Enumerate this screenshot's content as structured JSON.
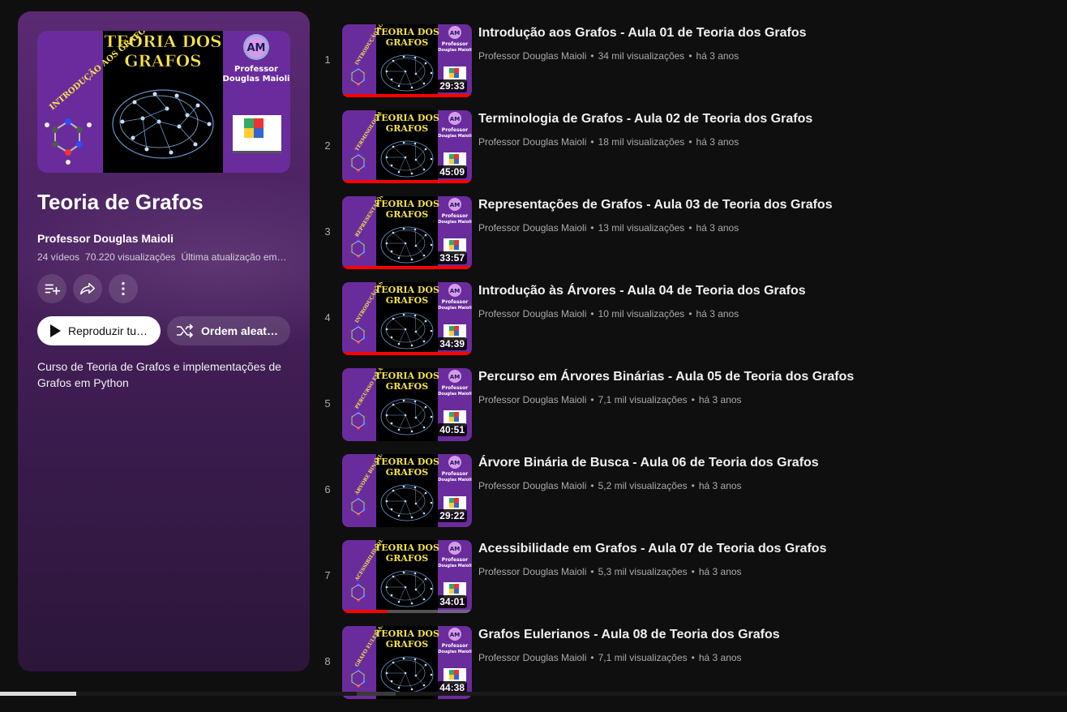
{
  "playlist": {
    "hero": {
      "top_title": "TEORIA DOS GRAFOS",
      "side_label": "INTRODUÇÃO AOS GRAFOS",
      "badge_initials": "AM",
      "badge_line1": "Professor",
      "badge_line2": "Douglas Maioli"
    },
    "title": "Teoria de Grafos",
    "owner": "Professor Douglas Maioli",
    "video_count": "24 vídeos",
    "views": "70.220 visualizações",
    "updated": "Última atualização em…",
    "play_label": "Reproduzir tu…",
    "shuffle_label": "Ordem aleató…",
    "description": "Curso de Teoria de Grafos e implementações de Grafos em Python"
  },
  "thumb_common": {
    "top_title": "TEORIA DOS GRAFOS",
    "badge_initials": "AM",
    "badge_line1": "Professor",
    "badge_line2": "Douglas Maioli"
  },
  "videos": [
    {
      "index": "1",
      "title": "Introdução aos Grafos - Aula 01 de Teoria dos Grafos",
      "channel": "Professor Douglas Maioli",
      "views": "34 mil visualizações",
      "age": "há 3 anos",
      "duration": "29:33",
      "side_label": "INTRODUÇÃO AOS GRAFOS",
      "progress": 1.0
    },
    {
      "index": "2",
      "title": "Terminologia de Grafos - Aula 02 de Teoria dos Grafos",
      "channel": "Professor Douglas Maioli",
      "views": "18 mil visualizações",
      "age": "há 3 anos",
      "duration": "45:09",
      "side_label": "TERMINOLOGIA",
      "progress": 1.0
    },
    {
      "index": "3",
      "title": "Representações de Grafos - Aula 03 de Teoria dos Grafos",
      "channel": "Professor Douglas Maioli",
      "views": "13 mil visualizações",
      "age": "há 3 anos",
      "duration": "33:57",
      "side_label": "REPRESENTAÇÕES DE GRAFOS",
      "progress": 1.0
    },
    {
      "index": "4",
      "title": "Introdução às Árvores - Aula 04 de Teoria dos Grafos",
      "channel": "Professor Douglas Maioli",
      "views": "10 mil visualizações",
      "age": "há 3 anos",
      "duration": "34:39",
      "side_label": "INTRODUÇÃO ÀS ÁRVORES",
      "progress": 1.0
    },
    {
      "index": "5",
      "title": "Percurso em Árvores Binárias - Aula 05 de Teoria dos Grafos",
      "channel": "Professor Douglas Maioli",
      "views": "7,1 mil visualizações",
      "age": "há 3 anos",
      "duration": "40:51",
      "side_label": "PERCURSO EM ÁRVORE BINÁRIA",
      "progress": 0
    },
    {
      "index": "6",
      "title": "Árvore Binária de Busca - Aula 06 de Teoria dos Grafos",
      "channel": "Professor Douglas Maioli",
      "views": "5,2 mil visualizações",
      "age": "há 3 anos",
      "duration": "29:22",
      "side_label": "ÁRVORE BINÁRIA DE BUSCA",
      "progress": 0
    },
    {
      "index": "7",
      "title": "Acessibilidade em Grafos - Aula 07 de Teoria dos Grafos",
      "channel": "Professor Douglas Maioli",
      "views": "5,3 mil visualizações",
      "age": "há 3 anos",
      "duration": "34:01",
      "side_label": "ACESSIBILIDADE",
      "progress": 0.35
    },
    {
      "index": "8",
      "title": "Grafos Eulerianos - Aula 08 de Teoria dos Grafos",
      "channel": "Professor Douglas Maioli",
      "views": "7,1 mil visualizações",
      "age": "há 3 anos",
      "duration": "44:38",
      "side_label": "GRAFO EULERIANO",
      "progress": 0
    }
  ],
  "colors": {
    "background": "#0f0f0f",
    "thumb_purple": "#6a2c9c",
    "thumb_title_yellow": "#f6e24a",
    "progress_red": "#ff0000",
    "meta_gray": "#aaaaaa"
  }
}
